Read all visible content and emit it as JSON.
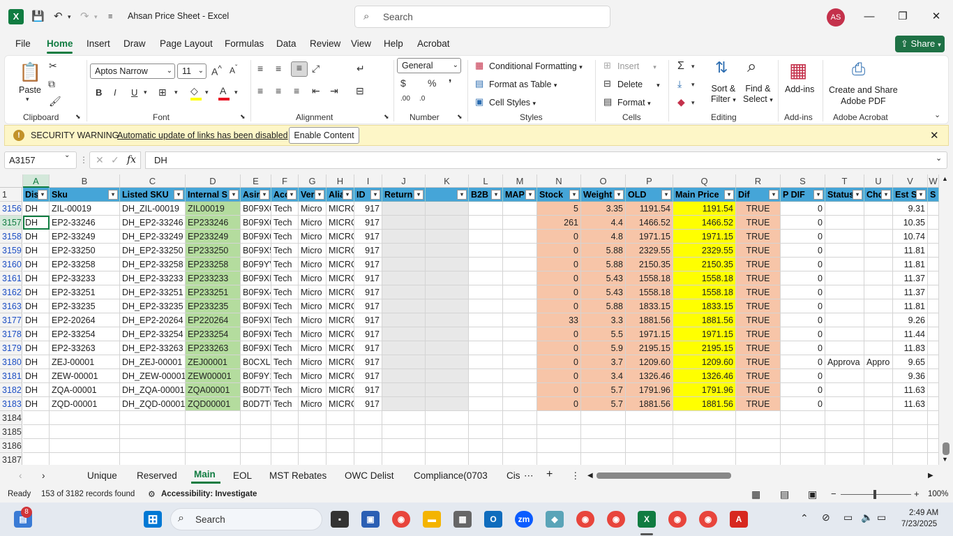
{
  "titlebar": {
    "app_name": "Excel",
    "title": "Ahsan Price Sheet  -  Excel",
    "search_placeholder": "Search",
    "user_initials": "AS"
  },
  "menu": {
    "tabs": [
      "File",
      "Home",
      "Insert",
      "Draw",
      "Page Layout",
      "Formulas",
      "Data",
      "Review",
      "View",
      "Help",
      "Acrobat"
    ],
    "share": "Share"
  },
  "ribbon": {
    "clipboard": {
      "paste": "Paste",
      "group": "Clipboard"
    },
    "font": {
      "name": "Aptos Narrow",
      "size": "11",
      "bold": "B",
      "italic": "I",
      "underline": "U",
      "font_color": "#e81123",
      "highlight_color": "#ffff00",
      "group": "Font"
    },
    "alignment": {
      "group": "Alignment"
    },
    "number": {
      "format": "General",
      "group": "Number"
    },
    "styles": {
      "cond": "Conditional Formatting",
      "table": "Format as Table",
      "cell": "Cell Styles",
      "group": "Styles"
    },
    "cells": {
      "insert": "Insert",
      "delete": "Delete",
      "format": "Format",
      "group": "Cells"
    },
    "editing": {
      "sort": "Sort &",
      "sort2": "Filter",
      "find": "Find &",
      "find2": "Select",
      "group": "Editing"
    },
    "addins": {
      "label": "Add-ins",
      "group": "Add-ins"
    },
    "acrobat": {
      "line1": "Create and Share",
      "line2": "Adobe PDF",
      "group": "Adobe Acrobat"
    }
  },
  "security": {
    "title": "SECURITY WARNING",
    "message": "Automatic update of links has been disabled",
    "button": "Enable Content"
  },
  "formula": {
    "namebox": "A3157",
    "value": "DH"
  },
  "grid": {
    "columns": [
      "A",
      "B",
      "C",
      "D",
      "E",
      "F",
      "G",
      "H",
      "I",
      "J",
      "K",
      "L",
      "M",
      "N",
      "O",
      "P",
      "Q",
      "R",
      "S",
      "T",
      "U",
      "V",
      "W"
    ],
    "headers": [
      "Dis",
      "Sku",
      "Listed SKU",
      "Internal S",
      "Asir",
      "Acc",
      "Ver",
      "Alia",
      "ID",
      "Return",
      "",
      "B2B",
      "MAP",
      "Stock",
      "Weight",
      "OLD",
      "Main Price",
      "Dif",
      "P DIF",
      "Status",
      "Cho",
      "Est S",
      "S"
    ],
    "header_row_num": "1",
    "rows": [
      {
        "n": "3156",
        "c": [
          "DH",
          "ZIL-00019",
          "DH_ZIL-00019",
          "ZIL00019",
          "B0F9X0",
          "Tech",
          "Micro",
          "MICRO",
          "917",
          "",
          "",
          "",
          "",
          "5",
          "3.35",
          "1191.54",
          "1191.54",
          "TRUE",
          "0",
          "",
          "",
          "9.31",
          ""
        ]
      },
      {
        "n": "3157",
        "c": [
          "DH",
          "EP2-33246",
          "DH_EP2-33246",
          "EP233246",
          "B0F9X0",
          "Tech",
          "Micro",
          "MICRO",
          "917",
          "",
          "",
          "",
          "",
          "261",
          "4.4",
          "1466.52",
          "1466.52",
          "TRUE",
          "0",
          "",
          "",
          "10.35",
          ""
        ]
      },
      {
        "n": "3158",
        "c": [
          "DH",
          "EP2-33249",
          "DH_EP2-33249",
          "EP233249",
          "B0F9X0",
          "Tech",
          "Micro",
          "MICRO",
          "917",
          "",
          "",
          "",
          "",
          "0",
          "4.8",
          "1971.15",
          "1971.15",
          "TRUE",
          "0",
          "",
          "",
          "10.74",
          ""
        ]
      },
      {
        "n": "3159",
        "c": [
          "DH",
          "EP2-33250",
          "DH_EP2-33250",
          "EP233250",
          "B0F9X5",
          "Tech",
          "Micro",
          "MICRO",
          "917",
          "",
          "",
          "",
          "",
          "0",
          "5.88",
          "2329.55",
          "2329.55",
          "TRUE",
          "0",
          "",
          "",
          "11.81",
          ""
        ]
      },
      {
        "n": "3160",
        "c": [
          "DH",
          "EP2-33258",
          "DH_EP2-33258",
          "EP233258",
          "B0F9YV",
          "Tech",
          "Micro",
          "MICRO",
          "917",
          "",
          "",
          "",
          "",
          "0",
          "5.88",
          "2150.35",
          "2150.35",
          "TRUE",
          "0",
          "",
          "",
          "11.81",
          ""
        ]
      },
      {
        "n": "3161",
        "c": [
          "DH",
          "EP2-33233",
          "DH_EP2-33233",
          "EP233233",
          "B0F9XD",
          "Tech",
          "Micro",
          "MICRO",
          "917",
          "",
          "",
          "",
          "",
          "0",
          "5.43",
          "1558.18",
          "1558.18",
          "TRUE",
          "0",
          "",
          "",
          "11.37",
          ""
        ]
      },
      {
        "n": "3162",
        "c": [
          "DH",
          "EP2-33251",
          "DH_EP2-33251",
          "EP233251",
          "B0F9X4",
          "Tech",
          "Micro",
          "MICRO",
          "917",
          "",
          "",
          "",
          "",
          "0",
          "5.43",
          "1558.18",
          "1558.18",
          "TRUE",
          "0",
          "",
          "",
          "11.37",
          ""
        ]
      },
      {
        "n": "3163",
        "c": [
          "DH",
          "EP2-33235",
          "DH_EP2-33235",
          "EP233235",
          "B0F9XD",
          "Tech",
          "Micro",
          "MICRO",
          "917",
          "",
          "",
          "",
          "",
          "0",
          "5.88",
          "1833.15",
          "1833.15",
          "TRUE",
          "0",
          "",
          "",
          "11.81",
          ""
        ]
      },
      {
        "n": "3177",
        "c": [
          "DH",
          "EP2-20264",
          "DH_EP2-20264",
          "EP220264",
          "B0F9XF",
          "Tech",
          "Micro",
          "MICRO",
          "917",
          "",
          "",
          "",
          "",
          "33",
          "3.3",
          "1881.56",
          "1881.56",
          "TRUE",
          "0",
          "",
          "",
          "9.26",
          ""
        ]
      },
      {
        "n": "3178",
        "c": [
          "DH",
          "EP2-33254",
          "DH_EP2-33254",
          "EP233254",
          "B0F9X0",
          "Tech",
          "Micro",
          "MICRO",
          "917",
          "",
          "",
          "",
          "",
          "0",
          "5.5",
          "1971.15",
          "1971.15",
          "TRUE",
          "0",
          "",
          "",
          "11.44",
          ""
        ]
      },
      {
        "n": "3179",
        "c": [
          "DH",
          "EP2-33263",
          "DH_EP2-33263",
          "EP233263",
          "B0F9XD",
          "Tech",
          "Micro",
          "MICRO",
          "917",
          "",
          "",
          "",
          "",
          "0",
          "5.9",
          "2195.15",
          "2195.15",
          "TRUE",
          "0",
          "",
          "",
          "11.83",
          ""
        ]
      },
      {
        "n": "3180",
        "c": [
          "DH",
          "ZEJ-00001",
          "DH_ZEJ-00001",
          "ZEJ00001",
          "B0CXL1",
          "Tech",
          "Micro",
          "MICRO",
          "917",
          "",
          "",
          "",
          "",
          "0",
          "3.7",
          "1209.60",
          "1209.60",
          "TRUE",
          "0",
          "Approva",
          "Appro",
          "9.65",
          ""
        ]
      },
      {
        "n": "3181",
        "c": [
          "DH",
          "ZEW-00001",
          "DH_ZEW-00001",
          "ZEW00001",
          "B0F9Y1",
          "Tech",
          "Micro",
          "MICRO",
          "917",
          "",
          "",
          "",
          "",
          "0",
          "3.4",
          "1326.46",
          "1326.46",
          "TRUE",
          "0",
          "",
          "",
          "9.36",
          ""
        ]
      },
      {
        "n": "3182",
        "c": [
          "DH",
          "ZQA-00001",
          "DH_ZQA-00001",
          "ZQA00001",
          "B0D7T0",
          "Tech",
          "Micro",
          "MICRO",
          "917",
          "",
          "",
          "",
          "",
          "0",
          "5.7",
          "1791.96",
          "1791.96",
          "TRUE",
          "0",
          "",
          "",
          "11.63",
          ""
        ]
      },
      {
        "n": "3183",
        "c": [
          "DH",
          "ZQD-00001",
          "DH_ZQD-00001",
          "ZQD00001",
          "B0D7T0",
          "Tech",
          "Micro",
          "MICRO",
          "917",
          "",
          "",
          "",
          "",
          "0",
          "5.7",
          "1881.56",
          "1881.56",
          "TRUE",
          "0",
          "",
          "",
          "11.63",
          ""
        ]
      }
    ],
    "empty_rows": [
      "3184",
      "3185",
      "3186",
      "3187"
    ],
    "colors": {
      "header": "#45a5d8",
      "green": "#b4dc9e",
      "gray": "#e8e8e8",
      "salmon": "#f7c5a8",
      "yellow": "#ffff00",
      "dif": "#f7c5a8"
    }
  },
  "sheets": {
    "tabs": [
      "Unique",
      "Reserved",
      "Main",
      "EOL",
      "MST Rebates",
      "OWC Delist",
      "Compliance(0703",
      "Cis"
    ],
    "active": "Main"
  },
  "status": {
    "ready": "Ready",
    "records": "153 of 3182 records found",
    "accessibility": "Accessibility: Investigate",
    "zoom": "100%"
  },
  "taskbar": {
    "search": "Search",
    "time": "2:49 AM",
    "date": "7/23/2025",
    "badge": "8"
  }
}
